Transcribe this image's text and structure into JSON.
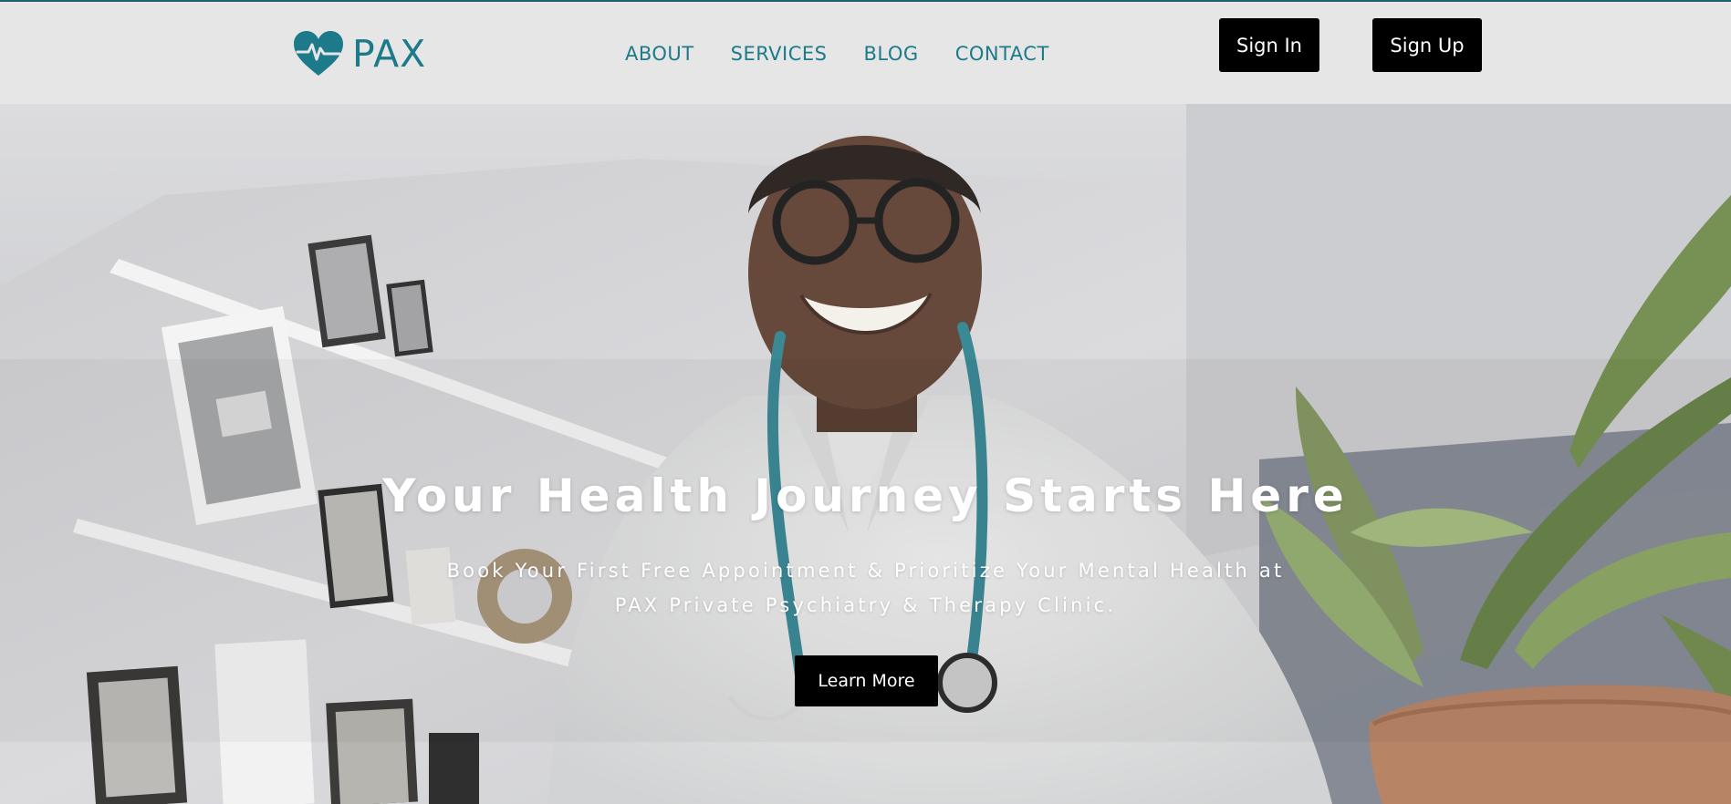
{
  "brand": {
    "name": "PAX",
    "color": "#1d7a8a",
    "icon": "heart-pulse-icon"
  },
  "nav": {
    "items": [
      {
        "label": "ABOUT"
      },
      {
        "label": "SERVICES"
      },
      {
        "label": "BLOG"
      },
      {
        "label": "CONTACT"
      }
    ]
  },
  "auth": {
    "sign_in_label": "Sign In",
    "sign_up_label": "Sign Up"
  },
  "hero": {
    "title": "Your Health Journey Starts Here",
    "subtitle_line1": "Book Your First Free Appointment & Prioritize Your Mental Health at",
    "subtitle_line2": "PAX Private Psychiatry & Therapy Clinic.",
    "cta_label": "Learn More"
  },
  "colors": {
    "accent": "#1d7a8a",
    "button_bg": "#000000",
    "header_bg": "#e6e6e6"
  }
}
